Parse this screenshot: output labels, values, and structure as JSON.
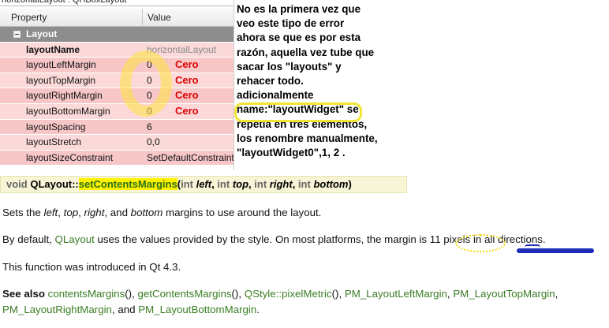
{
  "property_editor": {
    "object_title": "horizontalLayout : QHBoxLayout",
    "col_property": "Property",
    "col_value": "Value",
    "group": "Layout",
    "rows": [
      {
        "name": "layoutName",
        "value": "horizontalLayout"
      },
      {
        "name": "layoutLeftMargin",
        "value": "0",
        "note": "Cero"
      },
      {
        "name": "layoutTopMargin",
        "value": "0",
        "note": "Cero"
      },
      {
        "name": "layoutRightMargin",
        "value": "0",
        "note": "Cero"
      },
      {
        "name": "layoutBottomMargin",
        "value": "0",
        "note": "Cero"
      },
      {
        "name": "layoutSpacing",
        "value": "6"
      },
      {
        "name": "layoutStretch",
        "value": "0,0"
      },
      {
        "name": "layoutSizeConstraint",
        "value": "SetDefaultConstraint"
      }
    ]
  },
  "note": {
    "lines": [
      "No es la primera vez que",
      "veo este tipo de error",
      "ahora se que es por esta",
      "razón, aquella vez tube que",
      "sacar los \"layouts\" y",
      "rehacer todo.",
      "adicionalmente",
      "name:\"layoutWidget\" se",
      "repetia en tres elementos,",
      "los renombre manualmente,",
      "\"layoutWidget0\",1, 2 ."
    ]
  },
  "signature": {
    "ret": "void",
    "cls": "QLayout::",
    "fn": "setContentsMargins",
    "p1_type": "int",
    "p1_name": "left",
    "p2_type": "int",
    "p2_name": "top",
    "p3_type": "int",
    "p3_name": "right",
    "p4_type": "int",
    "p4_name": "bottom"
  },
  "doc": {
    "p1_a": "Sets the ",
    "p1_left": "left",
    "p1_b": ", ",
    "p1_top": "top",
    "p1_c": ", ",
    "p1_right": "right",
    "p1_d": ", and ",
    "p1_bottom": "bottom",
    "p1_e": " margins to use around the layout.",
    "p2_a": "By default, ",
    "p2_link": "QLayout",
    "p2_b": " uses the values provided by the style. On most platforms, the margin is ",
    "p2_px": "11 pixels",
    "p2_c": " in all directions.",
    "p3": "This function was introduced in Qt 4.3.",
    "see_also_label": "See also",
    "see_also_line1": [
      "contentsMargins",
      "()",
      ", ",
      "getContentsMargins",
      "()",
      ", ",
      "QStyle::pixelMetric",
      "()",
      ", ",
      "PM_LayoutLeftMargin",
      ", ",
      "PM_LayoutTopMargin",
      ","
    ],
    "see_also_line2_a": "PM_LayoutRightMargin",
    "see_also_line2_b": ", and ",
    "see_also_line2_c": "PM_LayoutBottomMargin",
    "see_also_line2_d": "."
  },
  "colors": {
    "link_green": "#3a7d23",
    "annotation_red": "#e00000",
    "highlight_yellow": "#fff200",
    "scribble_blue": "#1e2db8"
  }
}
